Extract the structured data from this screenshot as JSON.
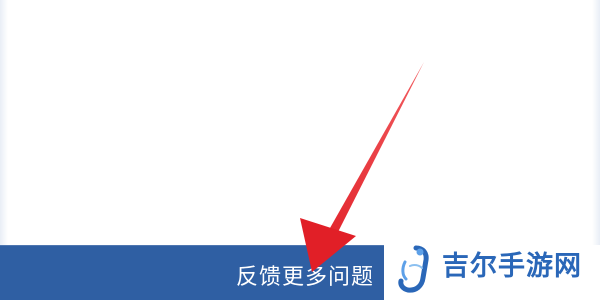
{
  "feedback_button": {
    "label": "反馈更多问题"
  },
  "watermark": {
    "text": "吉尔手游网",
    "logo_icon": "j-swirl-logo-icon",
    "color": "#2a67b8"
  },
  "annotation": {
    "arrow_icon": "red-arrow-icon",
    "color": "#e8232a"
  },
  "colors": {
    "bar": "#2f5fa3",
    "background": "#ffffff"
  }
}
